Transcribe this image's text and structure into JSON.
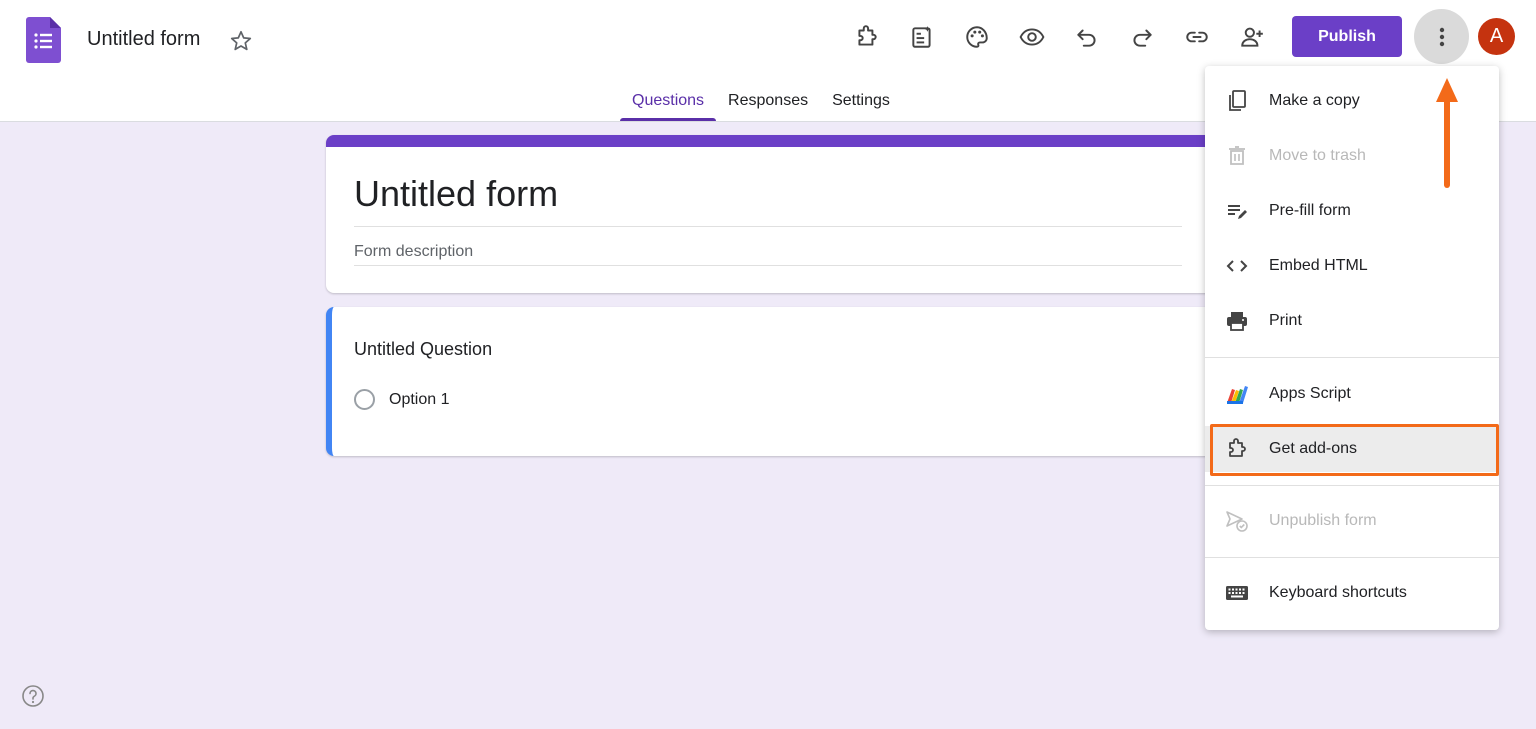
{
  "header": {
    "doc_title": "Untitled form",
    "publish_label": "Publish",
    "avatar_letter": "A"
  },
  "tabs": [
    {
      "label": "Questions",
      "active": true
    },
    {
      "label": "Responses",
      "active": false
    },
    {
      "label": "Settings",
      "active": false
    }
  ],
  "form": {
    "title": "Untitled form",
    "description_placeholder": "Form description",
    "question_title": "Untitled Question",
    "option_label": "Option 1"
  },
  "menu": {
    "items": [
      {
        "label": "Make a copy",
        "icon": "copy-icon",
        "disabled": false
      },
      {
        "label": "Move to trash",
        "icon": "trash-icon",
        "disabled": true
      },
      {
        "label": "Pre-fill form",
        "icon": "prefill-icon",
        "disabled": false
      },
      {
        "label": "Embed HTML",
        "icon": "code-icon",
        "disabled": false
      },
      {
        "label": "Print",
        "icon": "print-icon",
        "disabled": false
      },
      {
        "label": "Apps Script",
        "icon": "apps-script-icon",
        "disabled": false
      },
      {
        "label": "Get add-ons",
        "icon": "addons-icon",
        "disabled": false,
        "highlighted": true
      },
      {
        "label": "Unpublish form",
        "icon": "unpublish-icon",
        "disabled": true
      },
      {
        "label": "Keyboard shortcuts",
        "icon": "keyboard-icon",
        "disabled": false
      }
    ]
  },
  "colors": {
    "accent": "#6b3fc7",
    "annotation": "#f36a19",
    "background": "#efeaf8",
    "question_border": "#4285f4",
    "avatar": "#c5330f"
  }
}
